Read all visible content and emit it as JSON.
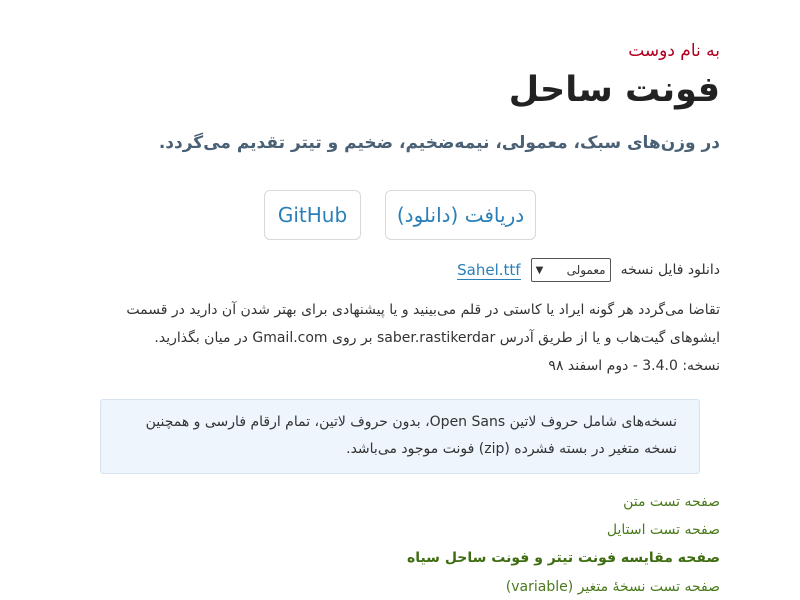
{
  "header": {
    "greeting": "به نام دوست",
    "title": "فونت ساحل",
    "subtitle": "در وزن‌های سبک، معمولی، نیمه‌ضخیم، ضخیم و تیتر تقدیم می‌گردد."
  },
  "buttons": {
    "download": "دریافت (دانلود)",
    "github": "GitHub"
  },
  "download_row": {
    "label": "دانلود فایل نسخه",
    "selected_version": "معمولی",
    "file_link": "Sahel.ttf"
  },
  "paragraph": {
    "line1": "تقاضا می‌گردد هر گونه ایراد یا کاستی در قلم می‌بینید و یا پیشنهادی برای بهتر شدن آن دارید در قسمت",
    "line2": "ایشوهای گیت‌هاب و یا از طریق آدرس saber.rastikerdar بر روی Gmail.com در میان بگذارید.",
    "line3": "نسخه: 3.4.0 - دوم اسفند ۹۸"
  },
  "note": {
    "line1": "نسخه‌های شامل حروف لاتین Open Sans، بدون حروف لاتین، تمام ارقام فارسی و همچنین",
    "line2": "نسخه متغیر در بسته فشرده (zip) فونت موجود می‌باشد."
  },
  "nav": {
    "item1": "صفحه تست متن",
    "item2": "صفحه تست استایل",
    "item3": "صفحه مقایسه فونت تیتر و فونت ساحل سیاه",
    "item4": "صفحه تست نسخهٔ متغیر (variable)"
  },
  "colors": {
    "greeting": "#b00020",
    "link": "#2a7fb8",
    "nav": "#4a7a1c",
    "note_bg": "#eef5fc"
  }
}
